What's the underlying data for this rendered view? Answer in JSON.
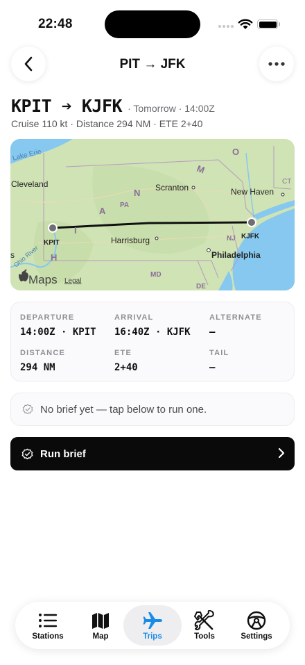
{
  "status_bar": {
    "time": "22:48"
  },
  "nav": {
    "title": "PIT → JFK"
  },
  "route": {
    "title": "KPIT ➔ KJFK",
    "meta": "· Tomorrow · 14:00Z",
    "subtitle": "Cruise 110 kt · Distance 294 NM · ETE 2+40"
  },
  "map": {
    "labels": {
      "lake_erie": "Lake Erie",
      "cleveland": "Cleveland",
      "scranton": "Scranton",
      "new_haven": "New Haven",
      "ct": "CT",
      "pa": "PA",
      "harrisburg": "Harrisburg",
      "nj": "NJ",
      "philadelphia": "Philadelphia",
      "md": "MD",
      "de": "DE",
      "ohio_river": "Ohio River",
      "kpit": "KPIT",
      "kjfk": "KJFK",
      "m": "M",
      "a": "A",
      "n": "N",
      "i": "I",
      "h": "H",
      "s": "s",
      "o": "O"
    },
    "brand": "Maps",
    "legal": "Legal",
    "colors": {
      "land": "#cfe3b5",
      "water": "#86c8ef",
      "route": "#111111"
    }
  },
  "info": {
    "departure": {
      "label": "DEPARTURE",
      "value": "14:00Z · KPIT"
    },
    "arrival": {
      "label": "ARRIVAL",
      "value": "16:40Z · KJFK"
    },
    "alternate": {
      "label": "ALTERNATE",
      "value": "—"
    },
    "distance": {
      "label": "DISTANCE",
      "value": "294 NM"
    },
    "ete": {
      "label": "ETE",
      "value": "2+40"
    },
    "tail": {
      "label": "TAIL",
      "value": "—"
    }
  },
  "brief_notice": "No brief yet — tap below to run one.",
  "run_brief": "Run brief",
  "tabs": [
    {
      "label": "Stations",
      "icon": "list-icon"
    },
    {
      "label": "Map",
      "icon": "map-icon"
    },
    {
      "label": "Trips",
      "icon": "airplane-icon",
      "active": true
    },
    {
      "label": "Tools",
      "icon": "tools-icon"
    },
    {
      "label": "Settings",
      "icon": "steering-wheel-icon"
    }
  ],
  "accent_color": "#1a8ce8"
}
